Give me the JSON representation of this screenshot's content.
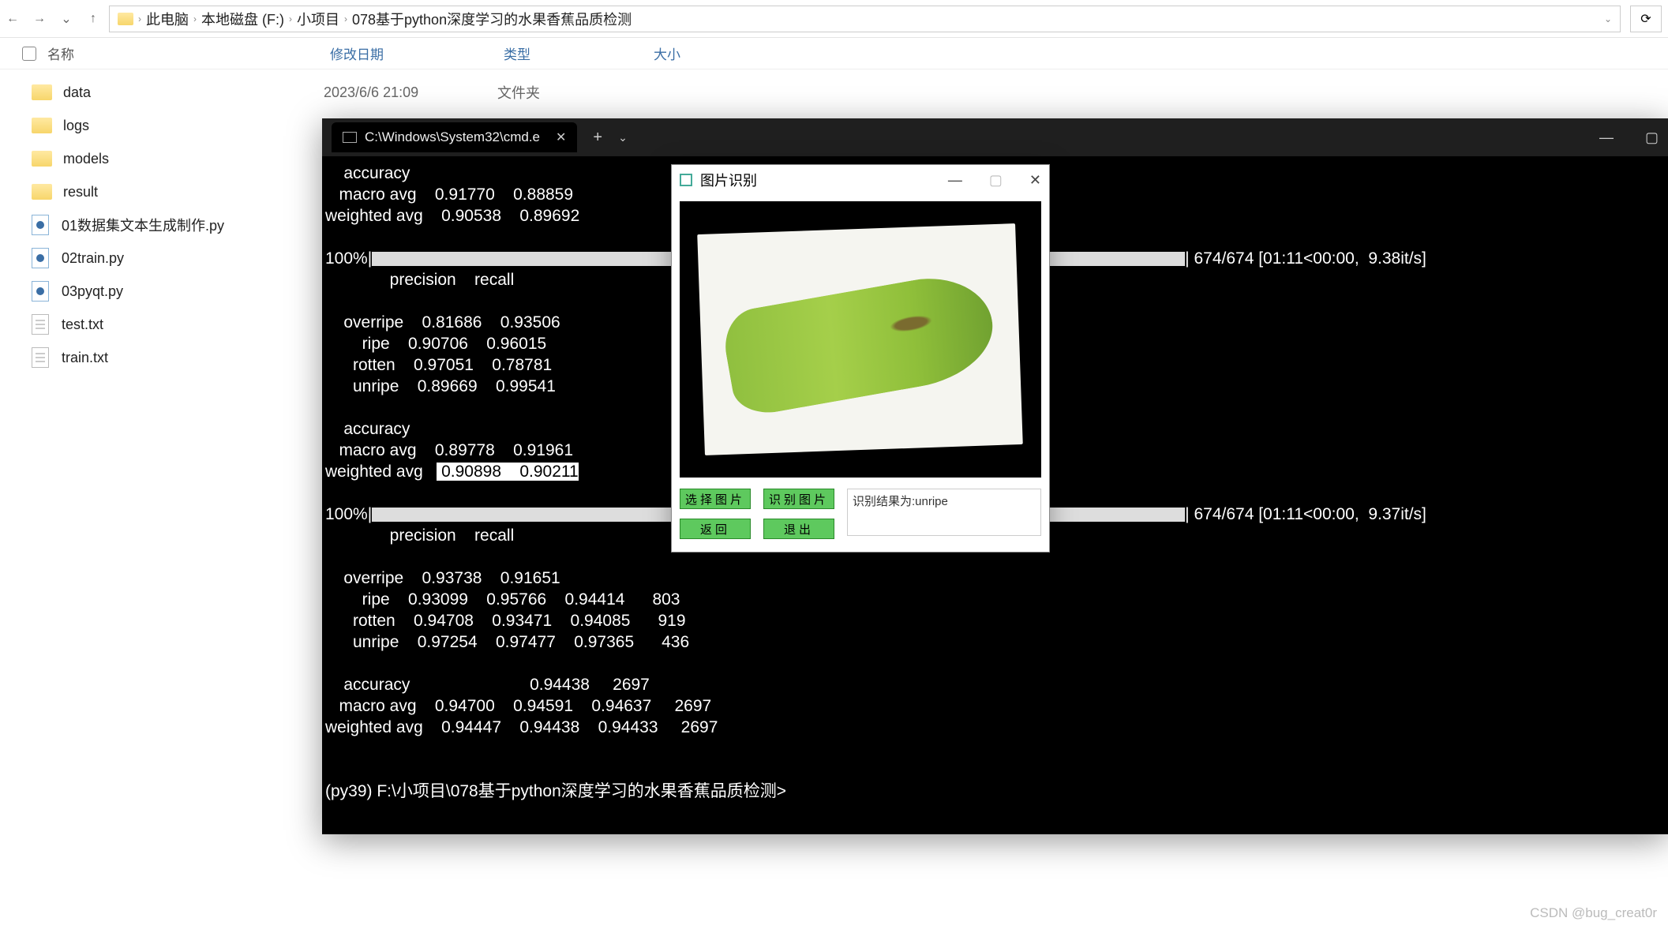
{
  "breadcrumb": [
    "此电脑",
    "本地磁盘 (F:)",
    "小项目",
    "078基于python深度学习的水果香蕉品质检测"
  ],
  "columns": {
    "name": "名称",
    "date": "修改日期",
    "type": "类型",
    "size": "大小"
  },
  "files": [
    {
      "icon": "folder",
      "name": "data",
      "date": "2023/6/6 21:09",
      "type": "文件夹"
    },
    {
      "icon": "folder",
      "name": "logs"
    },
    {
      "icon": "folder",
      "name": "models"
    },
    {
      "icon": "folder",
      "name": "result"
    },
    {
      "icon": "py",
      "name": "01数据集文本生成制作.py"
    },
    {
      "icon": "py",
      "name": "02train.py"
    },
    {
      "icon": "py",
      "name": "03pyqt.py"
    },
    {
      "icon": "txt",
      "name": "test.txt"
    },
    {
      "icon": "txt",
      "name": "train.txt"
    }
  ],
  "terminal": {
    "tab_title": "C:\\Windows\\System32\\cmd.e",
    "block1": {
      "rows": [
        {
          "label": "accuracy",
          "p": "",
          "r": ""
        },
        {
          "label": "macro avg",
          "p": "0.91770",
          "r": "0.88859"
        },
        {
          "label": "weighted avg",
          "p": "0.90538",
          "r": "0.89692"
        }
      ]
    },
    "progress1": {
      "pct": "100%",
      "tail": "| 674/674 [01:11<00:00,  9.38it/s]"
    },
    "header1": "              precision    recall",
    "block2": {
      "rows": [
        {
          "label": "overripe",
          "p": "0.81686",
          "r": "0.93506"
        },
        {
          "label": "ripe",
          "p": "0.90706",
          "r": "0.96015"
        },
        {
          "label": "rotten",
          "p": "0.97051",
          "r": "0.78781"
        },
        {
          "label": "unripe",
          "p": "0.89669",
          "r": "0.99541"
        }
      ]
    },
    "block3": {
      "rows": [
        {
          "label": "accuracy",
          "p": "",
          "r": ""
        },
        {
          "label": "macro avg",
          "p": "0.89778",
          "r": "0.91961"
        },
        {
          "label": "weighted avg",
          "p": "0.90898",
          "r": "0.90211",
          "hl": true
        }
      ]
    },
    "progress2": {
      "pct": "100%",
      "tail": "| 674/674 [01:11<00:00,  9.37it/s]"
    },
    "header2": "              precision    recall",
    "block4": {
      "rows": [
        {
          "label": "overripe",
          "p": "0.93738",
          "r": "0.91651",
          "f": "",
          "s": ""
        },
        {
          "label": "ripe",
          "p": "0.93099",
          "r": "0.95766",
          "f": "0.94414",
          "s": "803"
        },
        {
          "label": "rotten",
          "p": "0.94708",
          "r": "0.93471",
          "f": "0.94085",
          "s": "919"
        },
        {
          "label": "unripe",
          "p": "0.97254",
          "r": "0.97477",
          "f": "0.97365",
          "s": "436"
        }
      ]
    },
    "block5": {
      "rows": [
        {
          "label": "accuracy",
          "p": "",
          "r": "",
          "f": "0.94438",
          "s": "2697"
        },
        {
          "label": "macro avg",
          "p": "0.94700",
          "r": "0.94591",
          "f": "0.94637",
          "s": "2697"
        },
        {
          "label": "weighted avg",
          "p": "0.94447",
          "r": "0.94438",
          "f": "0.94433",
          "s": "2697"
        }
      ]
    },
    "prompt": "(py39) F:\\小项目\\078基于python深度学习的水果香蕉品质检测>"
  },
  "dialog": {
    "title": "图片识别",
    "buttons": {
      "select": "选择图片",
      "recognize": "识别图片",
      "back": "返回",
      "exit": "退出"
    },
    "result": "识别结果为:unripe"
  },
  "watermark": "CSDN @bug_creat0r"
}
